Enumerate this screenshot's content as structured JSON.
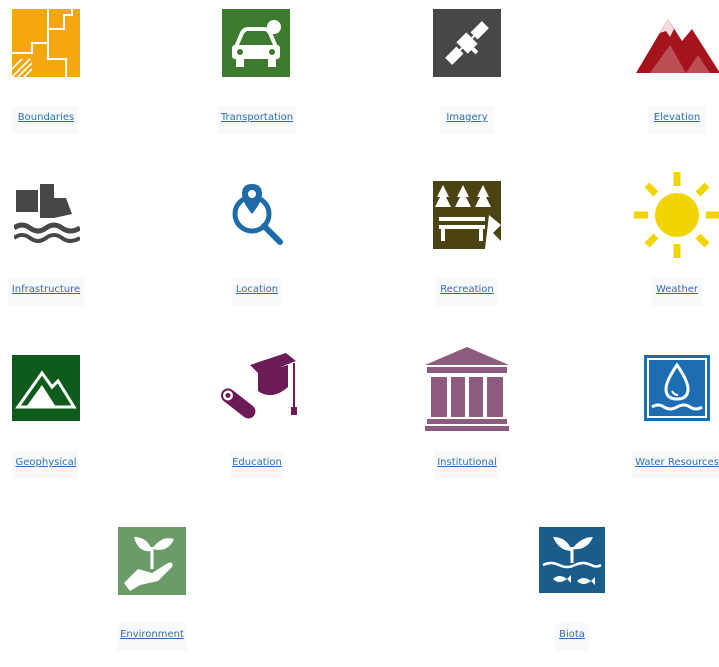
{
  "categories": [
    {
      "label": "Boundaries",
      "icon": "boundaries-icon",
      "color": "#f2a40e"
    },
    {
      "label": "Transportation",
      "icon": "car-icon",
      "color": "#3c7a2c"
    },
    {
      "label": "Imagery",
      "icon": "satellite-icon",
      "color": "#4a4a4a"
    },
    {
      "label": "Elevation",
      "icon": "mountain-icon",
      "color": "#a4141b"
    },
    {
      "label": "Infrastructure",
      "icon": "truck-water-icon",
      "color": "#4a4a4a"
    },
    {
      "label": "Location",
      "icon": "location-search-icon",
      "color": "#1f6aa6"
    },
    {
      "label": "Recreation",
      "icon": "forest-bench-icon",
      "color": "#4b4211"
    },
    {
      "label": "Weather",
      "icon": "sun-icon",
      "color": "#f0d400"
    },
    {
      "label": "Geophysical",
      "icon": "geophysical-mountain-icon",
      "color": "#0e5a1c"
    },
    {
      "label": "Education",
      "icon": "graduation-cap-icon",
      "color": "#6b1c56"
    },
    {
      "label": "Institutional",
      "icon": "government-building-icon",
      "color": "#8c5a7c"
    },
    {
      "label": "Water Resources",
      "icon": "water-drop-icon",
      "color": "#1c6cb0"
    },
    {
      "label": "Environment",
      "icon": "hand-plant-icon",
      "color": "#6b9a68"
    },
    {
      "label": "Biota",
      "icon": "plant-fish-icon",
      "color": "#1a5c8a"
    }
  ]
}
